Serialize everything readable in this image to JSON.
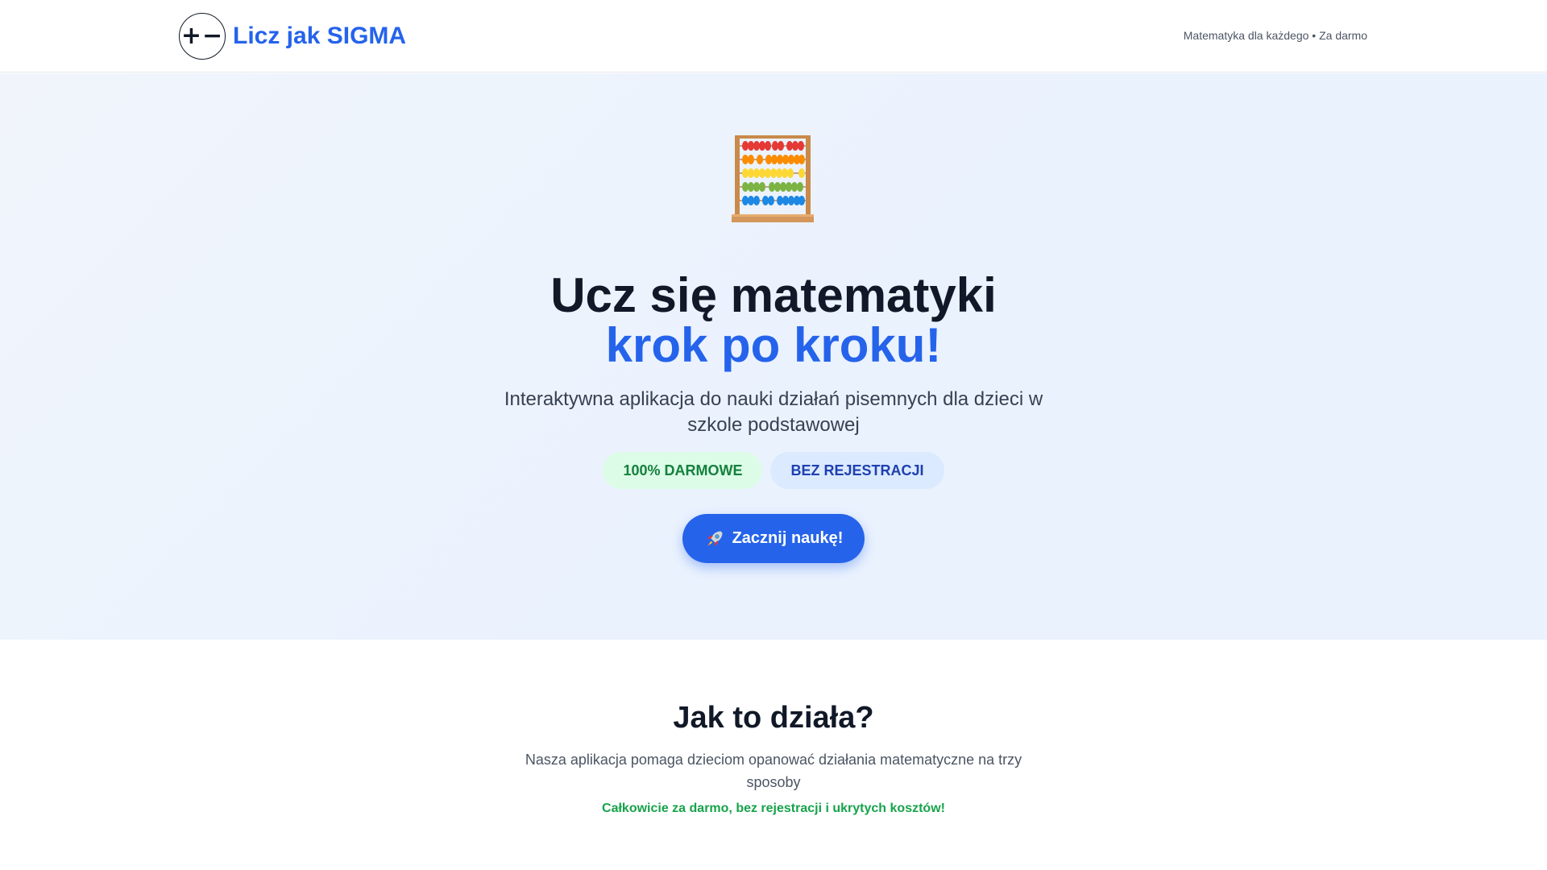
{
  "header": {
    "logo_mark": "+−",
    "logo_text": "Licz jak SIGMA",
    "tagline": "Matematyka dla każdego • Za darmo"
  },
  "hero": {
    "icon": "abacus-icon",
    "title_line1": "Ucz się matematyki",
    "title_line2": "krok po kroku!",
    "subtitle": "Interaktywna aplikacja do nauki działań pisemnych dla dzieci w szkole podstawowej",
    "badges": [
      "100% DARMOWE",
      "BEZ REJESTRACJI"
    ],
    "cta_icon": "rocket-icon",
    "cta_label": "Zacznij naukę!"
  },
  "how_it_works": {
    "title": "Jak to działa?",
    "subtitle": "Nasza aplikacja pomaga dzieciom opanować działania matematyczne na trzy sposoby",
    "note": "Całkowicie za darmo, bez rejestracji i ukrytych kosztów!"
  },
  "colors": {
    "accent": "#2563eb",
    "badge_green_bg": "#dcfce7",
    "badge_green_text": "#15803d",
    "badge_blue_bg": "#dbeafe",
    "badge_blue_text": "#1e40af",
    "note_green": "#16a34a"
  }
}
